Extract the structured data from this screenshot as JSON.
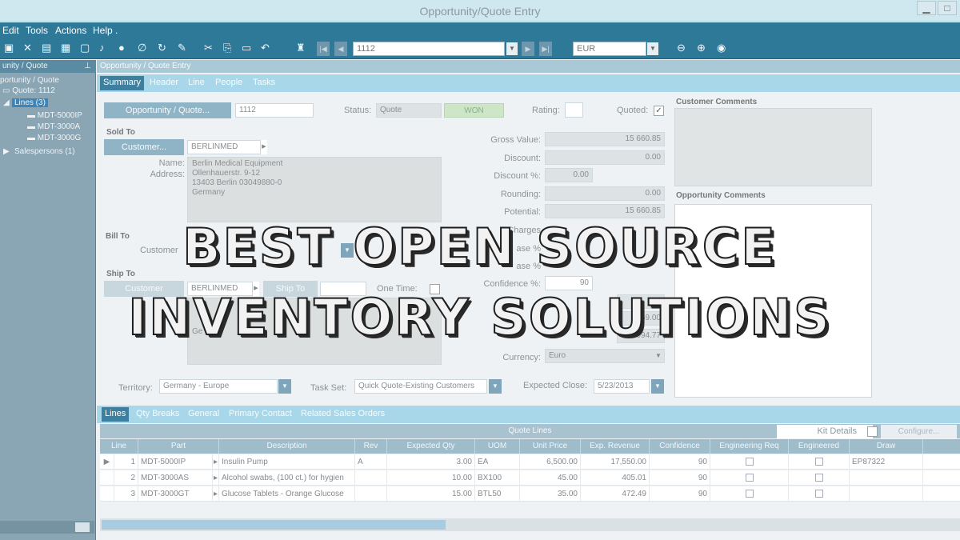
{
  "window": {
    "title": "Opportunity/Quote Entry",
    "minimize": "▁",
    "maximize": "□"
  },
  "menu": {
    "edit": "Edit",
    "tools": "Tools",
    "actions": "Actions",
    "help": "Help ."
  },
  "toolbar": {
    "quote_number": "1112",
    "currency": "EUR"
  },
  "tree": {
    "panel_title": "unity / Quote",
    "root": "portunity / Quote",
    "quote": "Quote: 1112",
    "lines": "Lines (3)",
    "children": [
      "MDT-5000IP",
      "MDT-3000A",
      "MDT-3000G"
    ],
    "salespersons": "Salespersons (1)"
  },
  "main": {
    "panel_title": "Opportunity / Quote Entry",
    "tabs": [
      "Summary",
      "Header",
      "Line",
      "People",
      "Tasks"
    ]
  },
  "summary": {
    "opp_button": "Opportunity / Quote...",
    "opp_number": "1112",
    "status_label": "Status:",
    "status_value": "Quote",
    "won": "WON",
    "rating_label": "Rating:",
    "quoted_label": "Quoted:",
    "quoted_checked": "✓",
    "sold_to": "Sold To",
    "customer_button": "Customer...",
    "customer_id": "BERLINMED",
    "name_label": "Name:",
    "address_label": "Address:",
    "address_lines": [
      "Berlin Medical Equipment",
      "Ollenhauerstr. 9-12",
      "13403 Berlin  03049880-0",
      "Germany"
    ],
    "bill_to": "Bill To",
    "bill_customer_label": "Customer",
    "ship_to": "Ship To",
    "ship_customer_button": "Customer",
    "ship_customer_id": "BERLINMED",
    "ship_to_button": "Ship To",
    "one_time_label": "One Time:",
    "ship_addr_partial": "Ge",
    "territory_label": "Territory:",
    "territory_value": "Germany - Europe",
    "task_set_label": "Task Set:",
    "task_set_value": "Quick Quote-Existing Customers",
    "expected_close_label": "Expected Close:",
    "expected_close_value": "5/23/2013"
  },
  "financials": {
    "gross_value_label": "Gross Value:",
    "gross_value": "15 660.85",
    "discount_label": "Discount:",
    "discount": "0.00",
    "discount_pct_label": "Discount %:",
    "discount_pct": "0.00",
    "rounding_label": "Rounding:",
    "rounding": "0.00",
    "potential_label": "Potential:",
    "potential": "15 660.85",
    "charges_partial": "c Charges",
    "base_pct_1": "ase %",
    "base_pct_2": "ase %",
    "confidence_label": "Confidence %:",
    "confidence": "90",
    "partial_value_1": "20",
    "partial_value_2": "169.00",
    "partial_value_3": "094.77",
    "currency_label": "Currency:",
    "currency_value": "Euro"
  },
  "comments": {
    "customer_comments": "Customer Comments",
    "opportunity_comments": "Opportunity Comments"
  },
  "lower_tabs": [
    "Lines",
    "Qty Breaks",
    "General",
    "Primary Contact",
    "Related Sales Orders"
  ],
  "grid": {
    "caption": "Quote Lines",
    "kit_details": "Kit Details",
    "configure": "Configure...",
    "columns": [
      "Line",
      "Part",
      "Description",
      "Rev",
      "Expected Qty",
      "UOM",
      "Unit Price",
      "Exp. Revenue",
      "Confidence",
      "Engineering Req",
      "Engineered",
      "Draw"
    ],
    "rows": [
      {
        "line": "1",
        "part": "MDT-5000IP",
        "description": "Insulin Pump",
        "rev": "A",
        "qty": "3.00",
        "uom": "EA",
        "unit_price": "6,500.00",
        "revenue": "17,550.00",
        "confidence": "90",
        "draw": "EP87322"
      },
      {
        "line": "2",
        "part": "MDT-3000AS",
        "description": "Alcohol swabs, (100 ct.) for hygien",
        "rev": "",
        "qty": "10.00",
        "uom": "BX100",
        "unit_price": "45.00",
        "revenue": "405.01",
        "confidence": "90",
        "draw": ""
      },
      {
        "line": "3",
        "part": "MDT-3000GT",
        "description": "Glucose Tablets - Orange Glucose",
        "rev": "",
        "qty": "15.00",
        "uom": "BTL50",
        "unit_price": "35.00",
        "revenue": "472.49",
        "confidence": "90",
        "draw": ""
      }
    ]
  },
  "overlay": {
    "line1": "BEST OPEN SOURCE",
    "line2": "INVENTORY SOLUTIONS"
  }
}
